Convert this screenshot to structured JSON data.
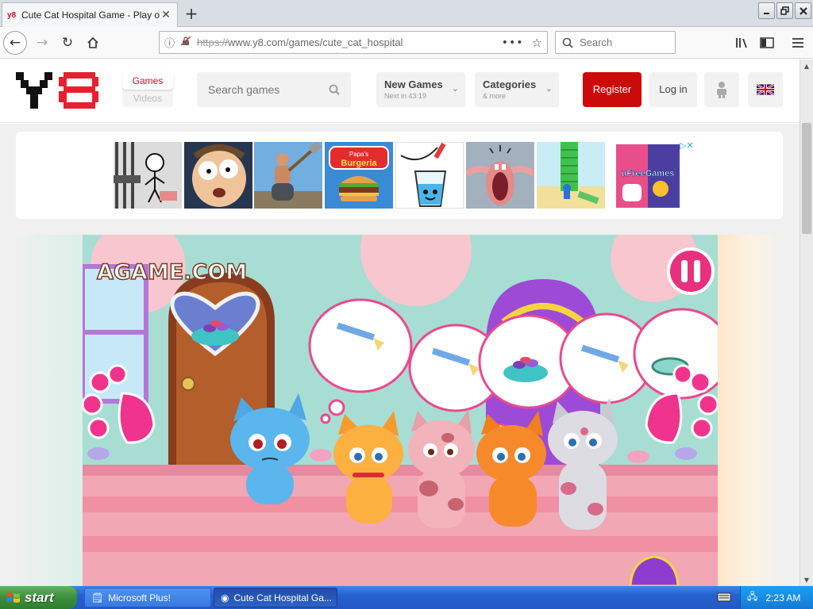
{
  "browser": {
    "tab_title": "Cute Cat Hospital Game - Play onli",
    "tab_favicon": "y8",
    "new_tab_symbol": "+",
    "url_https": "https://",
    "url_rest": "www.y8.com/games/cute_cat_hospital",
    "search_placeholder": "Search"
  },
  "site": {
    "nav_games": "Games",
    "nav_videos": "Videos",
    "search_placeholder": "Search games",
    "new_games_label": "New Games",
    "new_games_sub": "Next in 43:19",
    "categories_label": "Categories",
    "categories_sub": "& more",
    "register_label": "Register",
    "login_label": "Log in",
    "brand_red": "#cc0a0a"
  },
  "ads": {
    "adchoices_icon": "adchoices-icon",
    "thumbs": [
      {
        "name": "stickman-prison-thumb"
      },
      {
        "name": "cartoon-face-thumb"
      },
      {
        "name": "hammer-climber-thumb"
      },
      {
        "name": "papas-burgeria-thumb",
        "text": "Papa's Burgeria"
      },
      {
        "name": "happy-glass-thumb"
      },
      {
        "name": "mouth-dentist-thumb"
      },
      {
        "name": "tower-runner-thumb"
      },
      {
        "name": "ufreegames-thumb",
        "text": "uFreeGames"
      }
    ]
  },
  "game": {
    "watermark": "AGAME.COM",
    "pause_icon": "pause-icon"
  },
  "taskbar": {
    "start_label": "start",
    "items": [
      {
        "label": "Microsoft Plus!",
        "active": false
      },
      {
        "label": "Cute Cat Hospital Ga...",
        "active": true
      }
    ],
    "clock": "2:23 AM"
  }
}
